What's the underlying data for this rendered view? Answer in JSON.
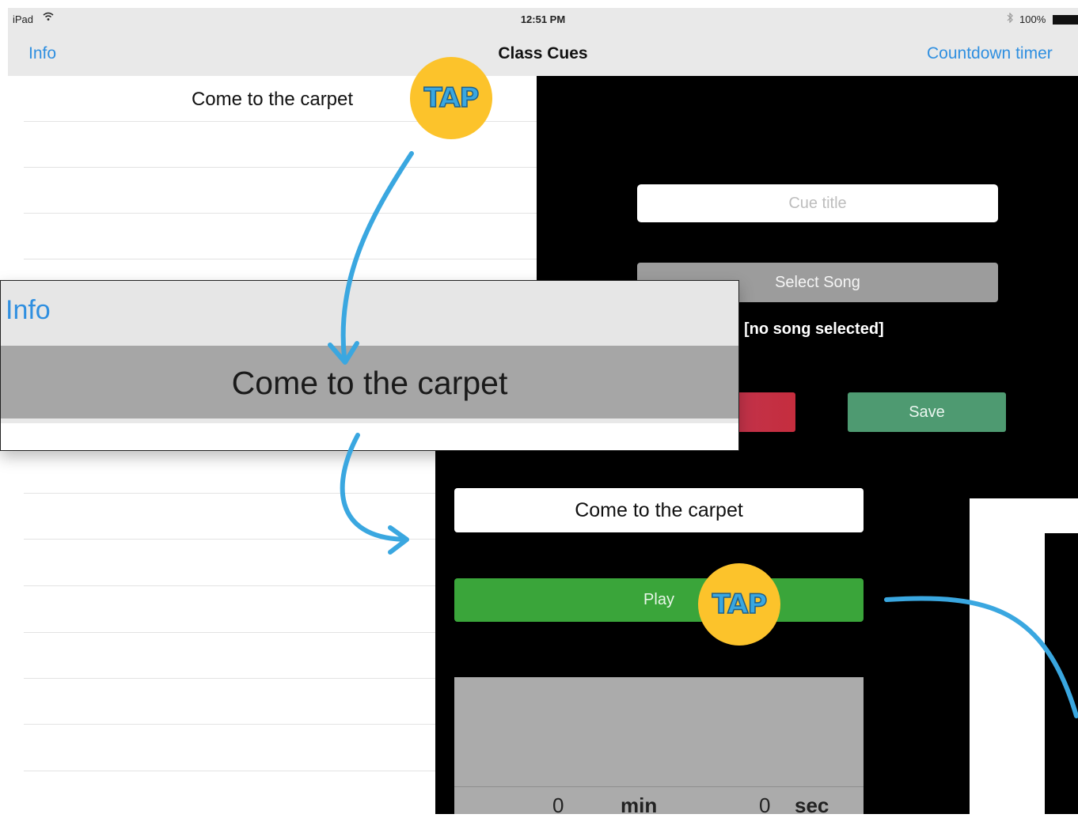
{
  "status_bar": {
    "device": "iPad",
    "time": "12:51 PM",
    "battery": "100%",
    "bluetooth_icon": "bluetooth-icon",
    "wifi_icon": "wifi-icon",
    "battery_icon": "battery-icon"
  },
  "nav_bar": {
    "left_button": "Info",
    "title": "Class Cues",
    "right_button": "Countdown timer"
  },
  "cue_list": {
    "items": [
      "Come to the carpet"
    ]
  },
  "edit_panel": {
    "cue_title_placeholder": "Cue title",
    "select_song_label": "Select Song",
    "song_status": "[no song selected]",
    "save_label": "Save"
  },
  "zoom_callout": {
    "info_label": "Info",
    "row_label": "Come to the carpet"
  },
  "play_panel": {
    "cue_title": "Come to the carpet",
    "play_label": "Play",
    "timer": {
      "minutes": "0",
      "min_unit": "min",
      "seconds": "0",
      "sec_unit": "sec"
    }
  },
  "annotations": {
    "tap_label_1": "TAP",
    "tap_label_2": "TAP"
  },
  "colors": {
    "accent": "#2f8fe0",
    "tap_badge": "#fcc32b",
    "arrow": "#3aa7e0",
    "play": "#3aa53a",
    "save": "#4e9a71",
    "delete": "#c2334a"
  }
}
